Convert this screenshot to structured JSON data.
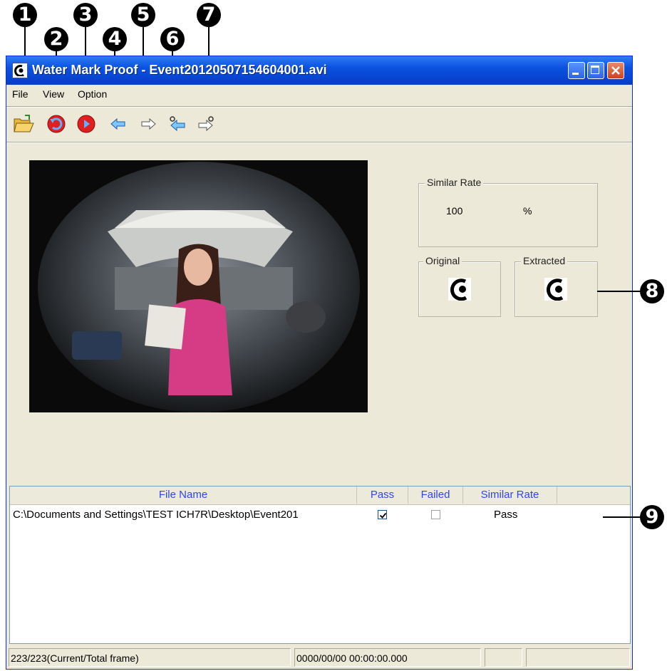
{
  "callouts": [
    "1",
    "2",
    "3",
    "4",
    "5",
    "6",
    "7",
    "8",
    "9"
  ],
  "window": {
    "title": "Water Mark Proof - Event20120507154604001.avi",
    "app_icon": "watermark-logo-icon",
    "controls": [
      "minimize-icon",
      "maximize-icon",
      "close-icon"
    ]
  },
  "menu": [
    {
      "label": "File"
    },
    {
      "label": "View"
    },
    {
      "label": "Option"
    }
  ],
  "toolbar": [
    {
      "icon": "open-folder-icon"
    },
    {
      "icon": "rewind-icon"
    },
    {
      "icon": "play-icon"
    },
    {
      "icon": "arrow-left-icon"
    },
    {
      "icon": "arrow-right-icon"
    },
    {
      "icon": "previous-key-arrow-icon"
    },
    {
      "icon": "next-key-arrow-icon"
    }
  ],
  "similar_rate": {
    "label": "Similar Rate",
    "value": "100",
    "unit": "%"
  },
  "watermarks": {
    "original_label": "Original",
    "extracted_label": "Extracted",
    "icon": "watermark-logo-icon"
  },
  "list": {
    "columns": [
      "File Name",
      "Pass",
      "Failed",
      "Similar Rate"
    ],
    "rows": [
      {
        "file_name": "C:\\Documents and Settings\\TEST ICH7R\\Desktop\\Event201",
        "pass": true,
        "failed": false,
        "similar_rate": "Pass"
      }
    ]
  },
  "status": {
    "frames": "223/223(Current/Total frame)",
    "timestamp": "0000/00/00 00:00:00.000"
  },
  "colors": {
    "titlebar": "#0a52e0",
    "window_bg": "#ece9d8",
    "column_header_text": "#3344ee"
  }
}
